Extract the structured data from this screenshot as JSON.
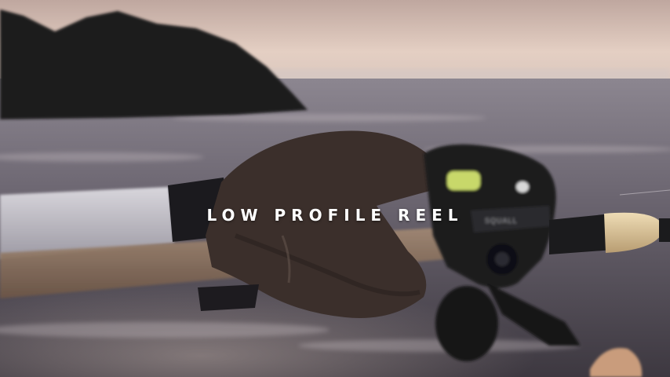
{
  "caption": "LOW PROFILE REEL",
  "reel_brand": "SQUALL",
  "colors": {
    "sky_top": "#c9b3aa",
    "sky_bottom": "#e8d3c7",
    "sea": "#6c6670",
    "rock": "#1f1b1f",
    "rod_grip": "#d9c39a",
    "reel_body": "#1a1a1c",
    "line_spool": "#c8d86a"
  }
}
